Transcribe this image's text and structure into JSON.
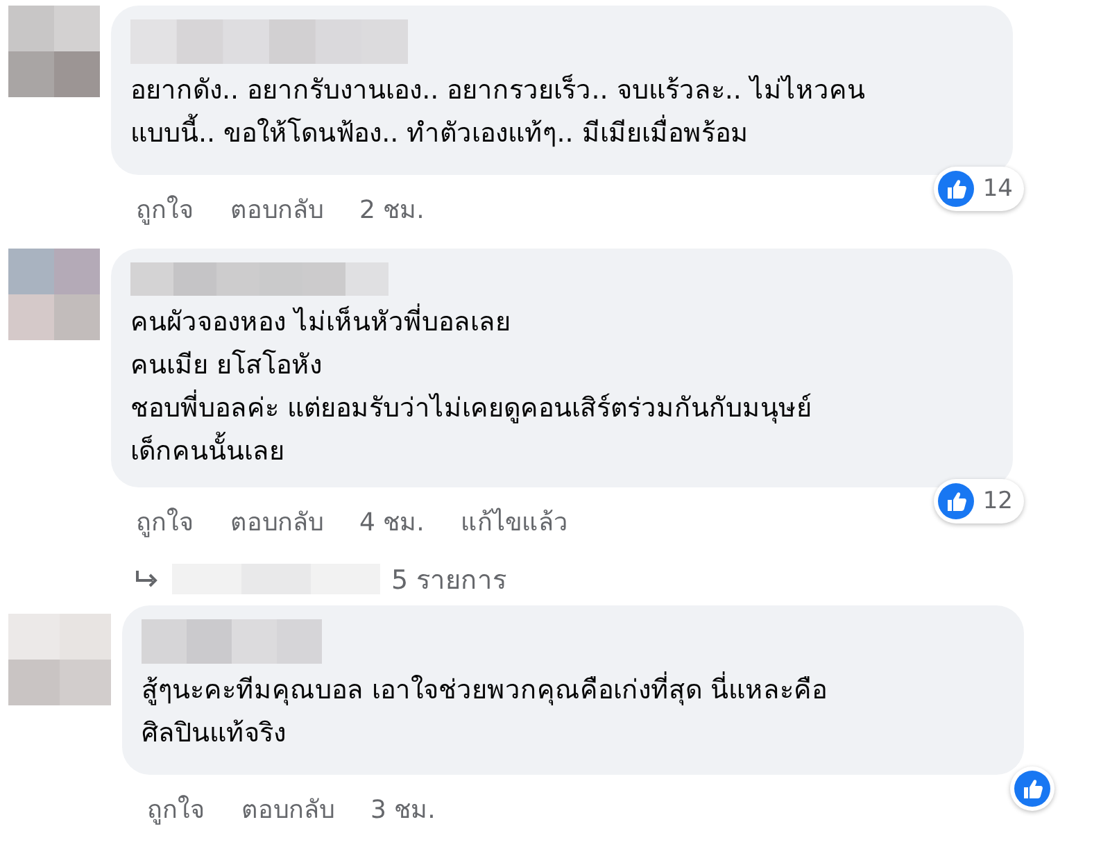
{
  "comments": [
    {
      "lines": [
        "อยากดัง.. อยากรับงานเอง.. อยากรวยเร็ว.. จบแร้วละ.. ไม่ไหวคน",
        "แบบนี้.. ขอให้โดนฟ้อง.. ทำตัวเองแท้ๆ.. มีเมียเมื่อพร้อม"
      ],
      "reaction": {
        "kind": "like",
        "count": "14"
      },
      "actions": [
        "ถูกใจ",
        "ตอบกลับ"
      ],
      "time": "2 ชม."
    },
    {
      "lines": [
        "คนผัวจองหอง ไม่เห็นหัวพี่บอลเลย",
        "คนเมีย ยโสโอหัง",
        "ชอบพี่บอลค่ะ แต่ยอมรับว่าไม่เคยดูคอนเสิร์ตร่วมกันกับมนุษย์",
        "เด็กคนนั้นเลย"
      ],
      "reaction": {
        "kind": "like",
        "count": "12"
      },
      "actions": [
        "ถูกใจ",
        "ตอบกลับ"
      ],
      "time": "4 ชม.",
      "edited": "แก้ไขแล้ว",
      "replies": {
        "label": "5 รายการ"
      }
    },
    {
      "lines": [
        "สู้ๆนะคะทีมคุณบอล เอาใจช่วยพวกคุณคือเก่งที่สุด นี่แหละคือ",
        "ศิลปินแท้จริง"
      ],
      "reaction": {
        "kind": "like"
      },
      "actions": [
        "ถูกใจ",
        "ตอบกลับ"
      ],
      "time": "3 ชม."
    }
  ]
}
